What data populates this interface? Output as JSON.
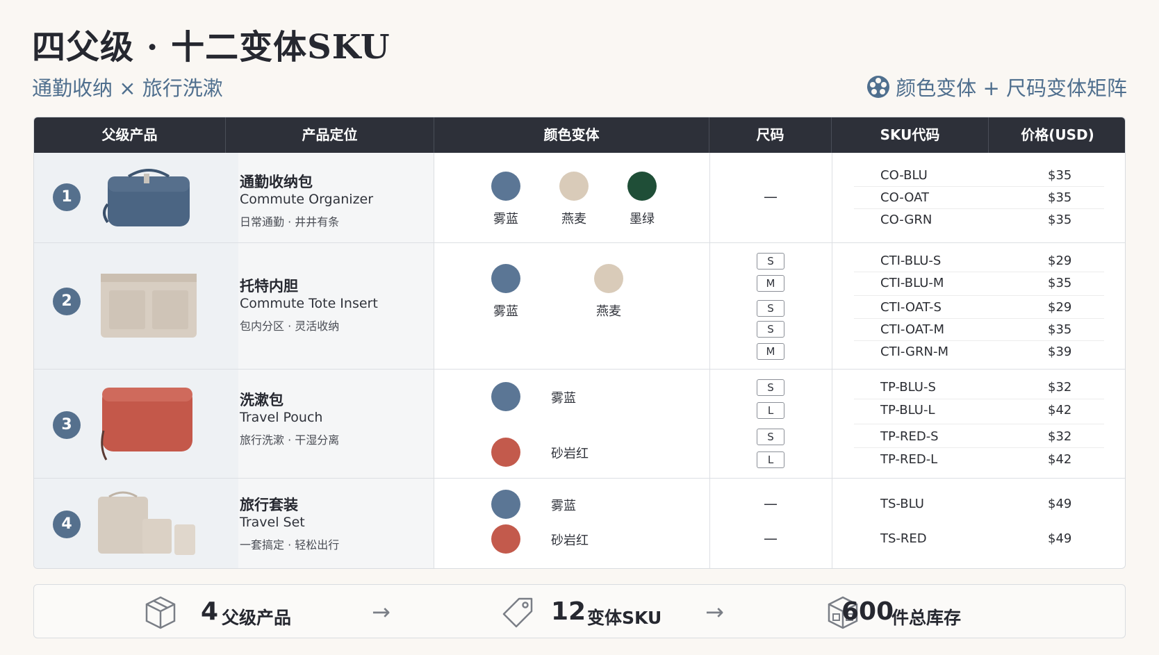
{
  "header": {
    "title": "四父级 · 十二变体SKU",
    "subtitle_left": "通勤收纳 × 旅行洗漱",
    "subtitle_right": "颜色变体 + 尺码变体矩阵"
  },
  "columns": [
    "父级产品",
    "产品定位",
    "颜色变体",
    "尺码",
    "SKU代码",
    "价格(USD)"
  ],
  "colors": {
    "mist_blue": "#5b7695",
    "oat": "#d9cbb9",
    "forest_green": "#1f4e37",
    "sandstone_red": "#c35a4c",
    "header_bg": "#2d3039",
    "accent": "#4f6f8e"
  },
  "products": [
    {
      "num": "1",
      "name_cn": "通勤收纳包",
      "name_en": "Commute Organizer",
      "desc": "日常通勤 · 井井有条",
      "image": "blue-organizer-bag-image",
      "colors": [
        "雾蓝",
        "燕麦",
        "墨绿"
      ],
      "size": "—",
      "skus": [
        {
          "code": "CO-BLU",
          "price": "$35"
        },
        {
          "code": "CO-OAT",
          "price": "$35"
        },
        {
          "code": "CO-GRN",
          "price": "$35"
        }
      ]
    },
    {
      "num": "2",
      "name_cn": "托特内胆",
      "name_en": "Commute Tote Insert",
      "desc": "包内分区 · 灵活收纳",
      "image": "beige-tote-insert-image",
      "colors": [
        "雾蓝",
        "燕麦"
      ],
      "sizes": [
        "S",
        "M",
        "S",
        "S",
        "M"
      ],
      "skus": [
        {
          "code": "CTI-BLU-S",
          "price": "$29"
        },
        {
          "code": "CTI-BLU-M",
          "price": "$35"
        },
        {
          "code": "CTI-OAT-S",
          "price": "$29"
        },
        {
          "code": "CTI-OAT-M",
          "price": "$35"
        },
        {
          "code": "CTI-GRN-M",
          "price": "$39"
        }
      ]
    },
    {
      "num": "3",
      "name_cn": "洗漱包",
      "name_en": "Travel Pouch",
      "desc": "旅行洗漱 · 干湿分离",
      "image": "red-travel-pouch-image",
      "colors": [
        "雾蓝",
        "砂岩红"
      ],
      "sizes": [
        "S",
        "L",
        "S",
        "L"
      ],
      "skus": [
        {
          "code": "TP-BLU-S",
          "price": "$32"
        },
        {
          "code": "TP-BLU-L",
          "price": "$42"
        },
        {
          "code": "TP-RED-S",
          "price": "$32"
        },
        {
          "code": "TP-RED-L",
          "price": "$42"
        }
      ]
    },
    {
      "num": "4",
      "name_cn": "旅行套装",
      "name_en": "Travel Set",
      "desc": "一套搞定 · 轻松出行",
      "image": "beige-travel-set-image",
      "colors": [
        "雾蓝",
        "砂岩红"
      ],
      "sizes": [
        "—",
        "—"
      ],
      "skus": [
        {
          "code": "TS-BLU",
          "price": "$49"
        },
        {
          "code": "TS-RED",
          "price": "$49"
        }
      ]
    }
  ],
  "summary": {
    "parents_num": "4",
    "parents_label": "父级产品",
    "skus_num": "12",
    "skus_label": "变体SKU",
    "stock_num": "600",
    "stock_label": "件总库存",
    "arrow": "→"
  }
}
